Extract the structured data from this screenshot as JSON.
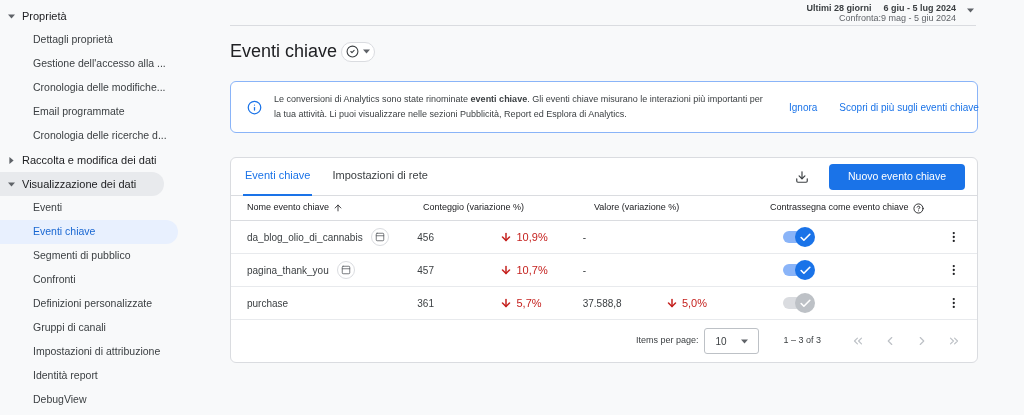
{
  "sidebar": {
    "sections": [
      {
        "label": "Proprietà",
        "expanded": true,
        "selected": false,
        "children": [
          {
            "label": "Dettagli proprietà",
            "selected": false
          },
          {
            "label": "Gestione dell'accesso alla ...",
            "selected": false
          },
          {
            "label": "Cronologia delle modifiche...",
            "selected": false
          },
          {
            "label": "Email programmate",
            "selected": false
          },
          {
            "label": "Cronologia delle ricerche d...",
            "selected": false
          }
        ]
      },
      {
        "label": "Raccolta e modifica dei dati",
        "expanded": false,
        "selected": false
      },
      {
        "label": "Visualizzazione dei dati",
        "expanded": true,
        "selected": true,
        "children": [
          {
            "label": "Eventi",
            "selected": false
          },
          {
            "label": "Eventi chiave",
            "selected": true
          },
          {
            "label": "Segmenti di pubblico",
            "selected": false
          },
          {
            "label": "Confronti",
            "selected": false
          },
          {
            "label": "Definizioni personalizzate",
            "selected": false
          },
          {
            "label": "Gruppi di canali",
            "selected": false
          },
          {
            "label": "Impostazioni di attribuzione",
            "selected": false
          },
          {
            "label": "Identità report",
            "selected": false
          },
          {
            "label": "DebugView",
            "selected": false
          }
        ]
      }
    ]
  },
  "date_range": {
    "period": "Ultimi 28 giorni",
    "range": "6 giu - 5 lug 2024",
    "compare": "Confronta:9 mag - 5 giu 2024"
  },
  "page_title": "Eventi chiave",
  "banner": {
    "text": "Le conversioni di Analytics sono state rinominate **eventi chiave**. Gli eventi chiave misurano le interazioni più importanti per la tua attività. Li puoi visualizzare nelle sezioni Pubblicità, Report ed Esplora di Analytics.",
    "actions": [
      "Ignora",
      "Scopri di più sugli eventi chiave"
    ]
  },
  "tabs": [
    {
      "label": "Eventi chiave",
      "selected": true
    },
    {
      "label": "Impostazioni di rete",
      "selected": false
    }
  ],
  "new_button": "Nuovo evento chiave",
  "table": {
    "columns": [
      "Nome evento chiave",
      "Conteggio (variazione %)",
      "Valore (variazione %)",
      "Contrassegna come evento chiave"
    ],
    "rows": [
      {
        "name": "da_blog_olio_di_cannabis",
        "has_icon": true,
        "count": "456",
        "count_change": "10,9%",
        "value": "-",
        "on": true,
        "disabled": false
      },
      {
        "name": "pagina_thank_you",
        "has_icon": true,
        "count": "457",
        "count_change": "10,7%",
        "value": "-",
        "on": true,
        "disabled": false
      },
      {
        "name": "purchase",
        "has_icon": false,
        "count": "361",
        "count_change": "5,7%",
        "value": "37.588,8",
        "value_change": "5,0%",
        "on": true,
        "disabled": true
      }
    ]
  },
  "pagination": {
    "label": "Items per page:",
    "page_size": "10",
    "range": "1 – 3 of 3"
  }
}
